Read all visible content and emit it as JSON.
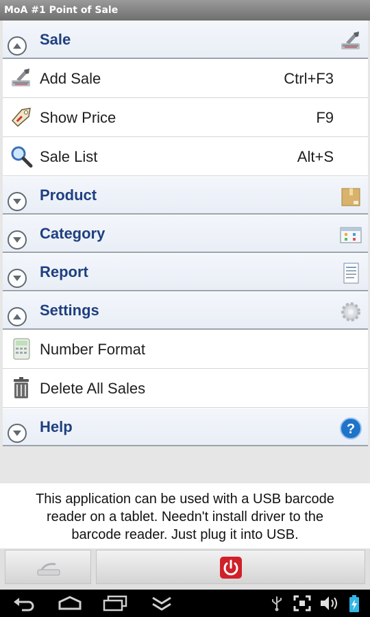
{
  "window": {
    "title": "MoA #1 Point of Sale"
  },
  "menu": {
    "sale": {
      "label": "Sale",
      "items": [
        {
          "label": "Add Sale",
          "shortcut": "Ctrl+F3"
        },
        {
          "label": "Show Price",
          "shortcut": "F9"
        },
        {
          "label": "Sale List",
          "shortcut": "Alt+S"
        }
      ]
    },
    "product": {
      "label": "Product"
    },
    "category": {
      "label": "Category"
    },
    "report": {
      "label": "Report"
    },
    "settings": {
      "label": "Settings",
      "items": [
        {
          "label": "Number Format"
        },
        {
          "label": "Delete All Sales"
        }
      ]
    },
    "help": {
      "label": "Help"
    }
  },
  "info": {
    "lines": [
      "This application can be used with a USB barcode",
      "reader on a tablet. Needn't install driver to the",
      "barcode reader. Just plug it into USB."
    ]
  },
  "icons": {
    "expanded": "collapse-up-icon",
    "collapsed": "expand-down-icon",
    "power": "power-icon",
    "accent": "#1f3f80",
    "power_color": "#d0202a"
  }
}
